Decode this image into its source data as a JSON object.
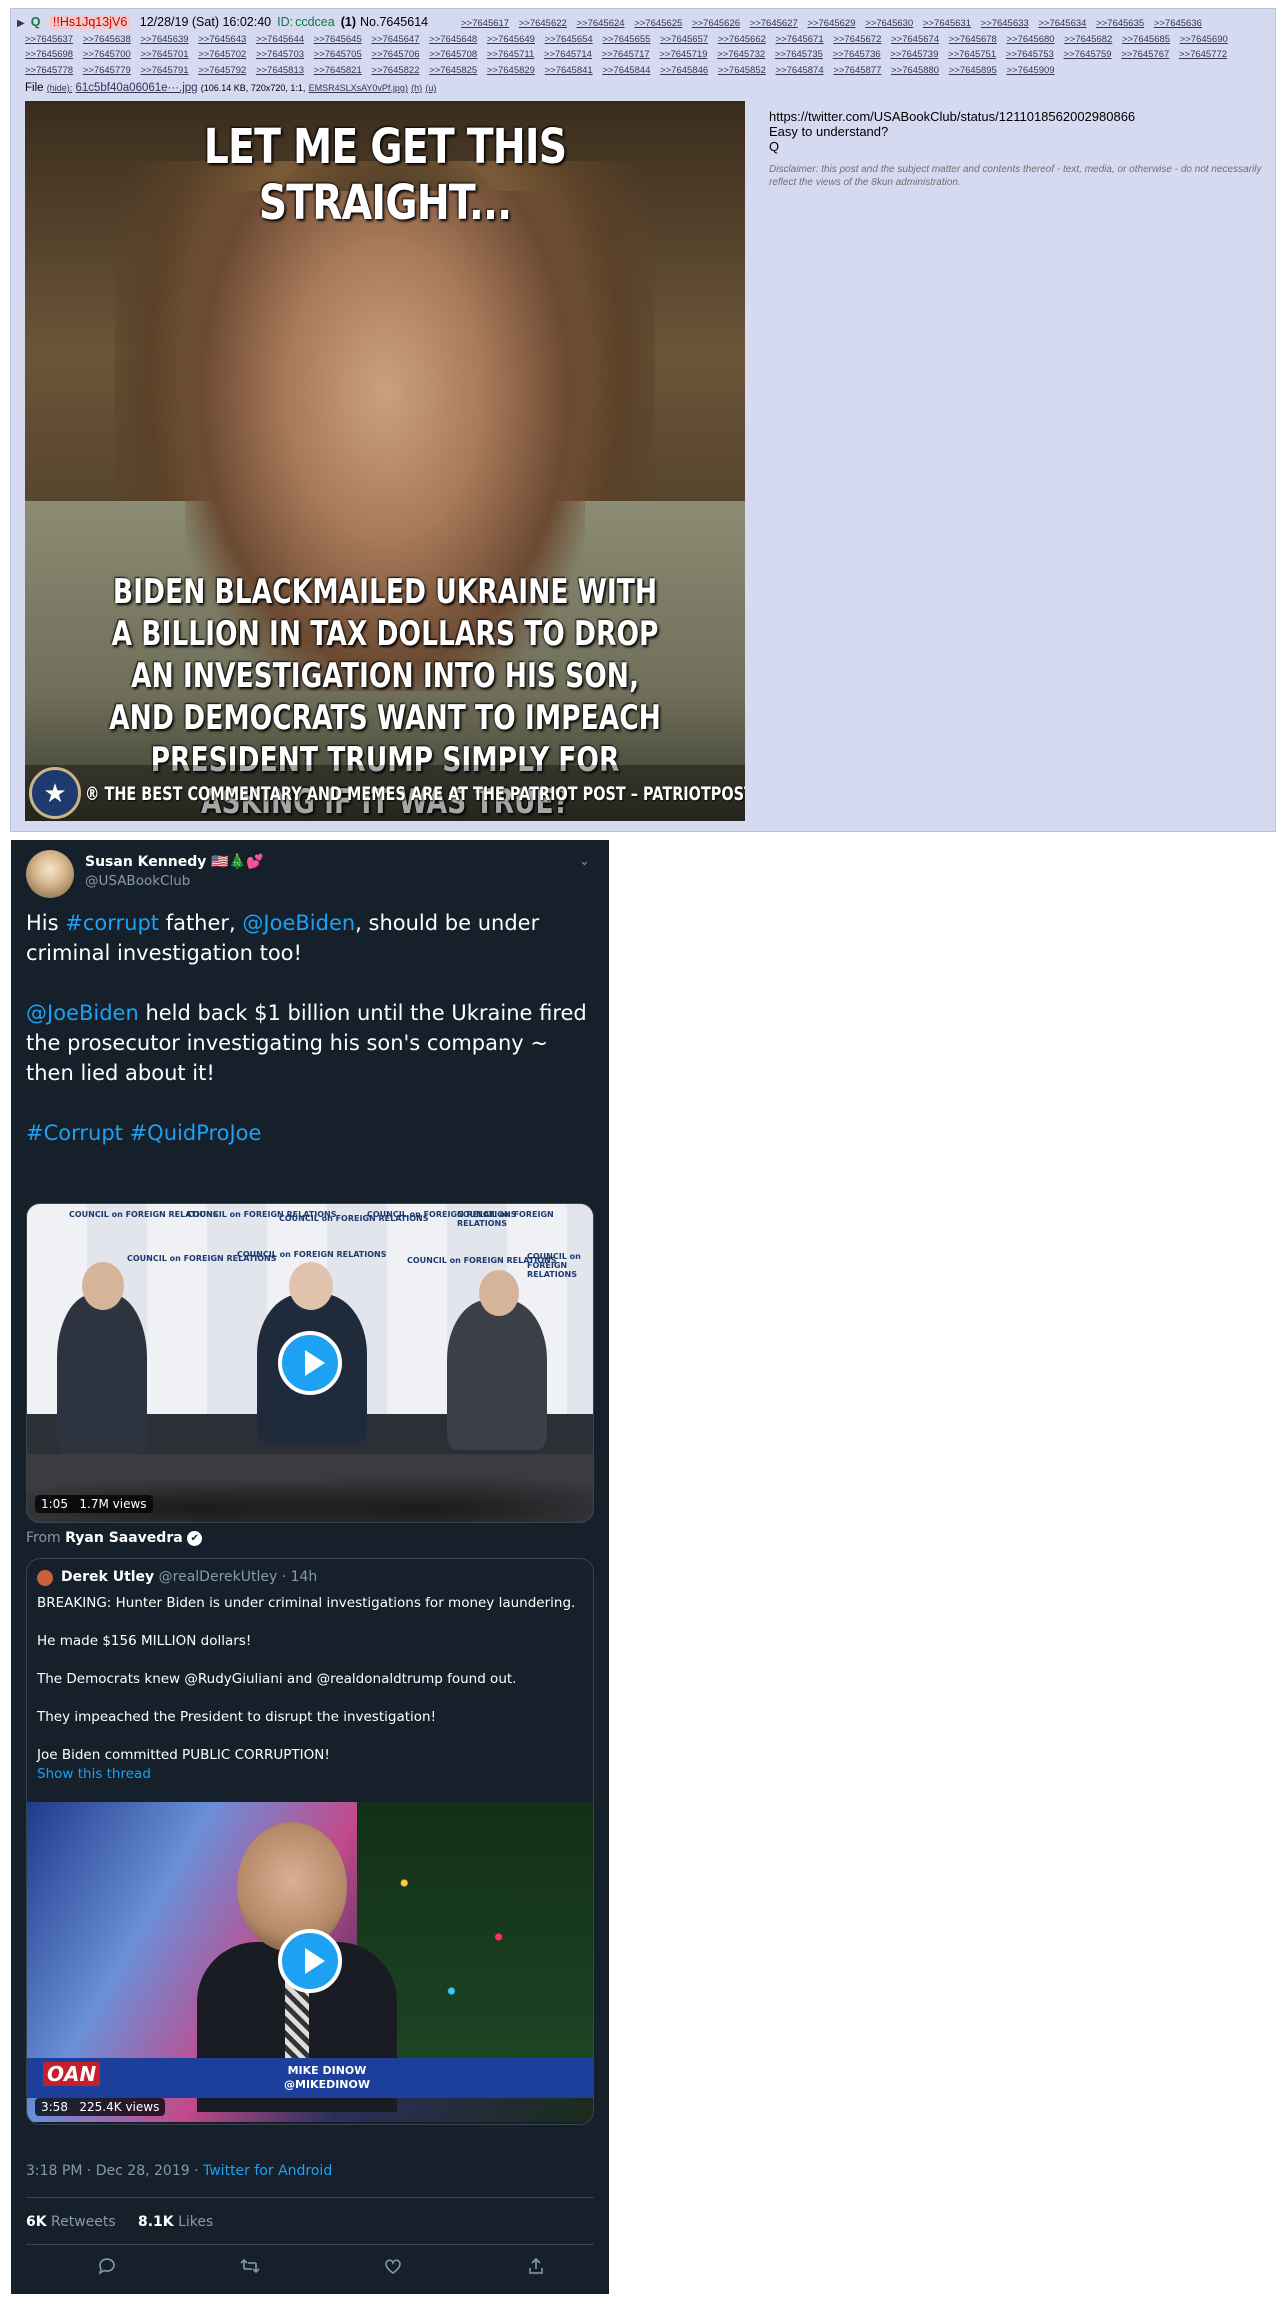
{
  "post": {
    "expander": "▶",
    "name": "Q",
    "tripcode": "!!Hs1Jq13jV6",
    "datetime": "12/28/19 (Sat) 16:02:40",
    "id_label": "ID:",
    "id_value": "ccdcea",
    "count": "(1)",
    "number": "No.7645614",
    "backlinks": [
      ">>7645617",
      ">>7645622",
      ">>7645624",
      ">>7645625",
      ">>7645626",
      ">>7645627",
      ">>7645629",
      ">>7645630",
      ">>7645631",
      ">>7645633",
      ">>7645634",
      ">>7645635",
      ">>7645636",
      ">>7645637",
      ">>7645638",
      ">>7645639",
      ">>7645643",
      ">>7645644",
      ">>7645645",
      ">>7645647",
      ">>7645648",
      ">>7645649",
      ">>7645654",
      ">>7645655",
      ">>7645657",
      ">>7645662",
      ">>7645671",
      ">>7645672",
      ">>7645674",
      ">>7645678",
      ">>7645680",
      ">>7645682",
      ">>7645685",
      ">>7645690",
      ">>7645698",
      ">>7645700",
      ">>7645701",
      ">>7645702",
      ">>7645703",
      ">>7645705",
      ">>7645706",
      ">>7645708",
      ">>7645711",
      ">>7645714",
      ">>7645717",
      ">>7645719",
      ">>7645732",
      ">>7645735",
      ">>7645736",
      ">>7645739",
      ">>7645751",
      ">>7645753",
      ">>7645759",
      ">>7645767",
      ">>7645772",
      ">>7645778",
      ">>7645779",
      ">>7645791",
      ">>7645792",
      ">>7645813",
      ">>7645821",
      ">>7645822",
      ">>7645825",
      ">>7645829",
      ">>7645841",
      ">>7645844",
      ">>7645846",
      ">>7645852",
      ">>7645874",
      ">>7645877",
      ">>7645880",
      ">>7645895",
      ">>7645909"
    ],
    "file_label": "File",
    "file_hide": "(hide):",
    "file_name": "61c5bf40a06061e···.jpg",
    "file_meta": "(106.14 KB, 720x720, 1:1,",
    "file_orig": "EMSR4SLXsAY0vPf.jpg)",
    "file_h": "(h)",
    "file_u": "(u)",
    "meme_top": "LET ME GET THIS STRAIGHT...",
    "meme_bottom": "BIDEN BLACKMAILED UKRAINE WITH A BILLION IN TAX DOLLARS TO DROP AN INVESTIGATION INTO HIS SON, AND DEMOCRATS WANT TO IMPEACH PRESIDENT TRUMP SIMPLY FOR ASKING IF IT WAS TRUE?",
    "meme_footer": "THE BEST COMMENTARY AND MEMES ARE AT THE PATRIOT POST – PATRIOTPOST.US",
    "meme_reg": "®",
    "body_url": "https://twitter.com/USABookClub/status/1211018562002980866",
    "body_line2": "Easy to understand?",
    "body_sign": "Q",
    "disclaimer": "Disclaimer: this post and the subject matter and contents thereof - text, media, or otherwise - do not necessarily reflect the views of the 8kun administration."
  },
  "tweet": {
    "name": "Susan Kennedy 🇺🇸🎄💕",
    "handle": "@USABookClub",
    "chevron": "⌄",
    "p1_a": "His ",
    "p1_tag": "#corrupt",
    "p1_b": " father, ",
    "p1_mention": "@JoeBiden",
    "p1_c": ", should be under criminal investigation too!",
    "p2_mention": "@JoeBiden",
    "p2_text": " held back $1 billion until the Ukraine fired the prosecutor investigating his son's company ~ then lied about it!",
    "p3_tag1": "#Corrupt",
    "p3_tag2": "#QuidProJoe",
    "video1_duration": "1:05",
    "video1_views": "1.7M views",
    "cfr_label": "COUNCIL on FOREIGN RELATIONS",
    "from_label": "From",
    "from_name": "Ryan Saavedra",
    "quote": {
      "name": "Derek Utley",
      "handle": "@realDerekUtley",
      "time": "· 14h",
      "lines": [
        "BREAKING: Hunter Biden is under criminal investigations for money laundering.",
        "He made $156 MILLION dollars!",
        "The Democrats knew @RudyGiuliani and @realdonaldtrump found out.",
        "They impeached the President to disrupt the investigation!",
        "Joe Biden committed PUBLIC CORRUPTION!"
      ],
      "show_thread": "Show this thread",
      "video_duration": "3:58",
      "video_views": "225.4K views",
      "channel": "OAN",
      "anchor_name": "MIKE DINOW",
      "anchor_handle": "@MIKEDINOW"
    },
    "timestamp": "3:18 PM · Dec 28, 2019 · ",
    "source": "Twitter for Android",
    "retweets_count": "6K",
    "retweets_label": " Retweets",
    "likes_count": "8.1K",
    "likes_label": " Likes",
    "actions": {
      "reply_icon": "reply-icon",
      "retweet_icon": "retweet-icon",
      "like_icon": "heart-icon",
      "share_icon": "share-icon"
    },
    "colors": {
      "background": "#15202b",
      "link": "#1da1f2",
      "muted": "#8899a6"
    }
  }
}
